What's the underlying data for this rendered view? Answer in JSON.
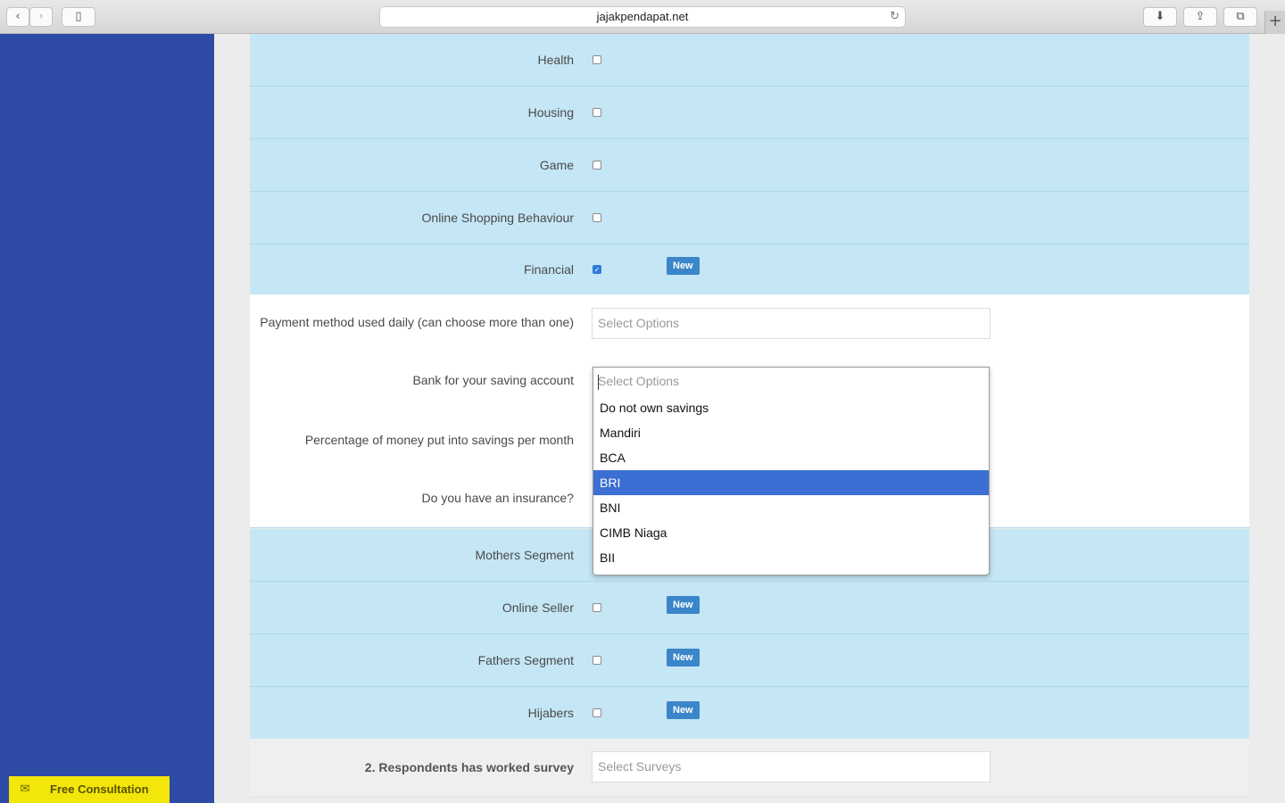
{
  "browser": {
    "url": "jajakpendapat.net",
    "back_icon": "chevron-left",
    "forward_icon": "chevron-right",
    "sidebar_icon": "sidebar",
    "reload_icon": "reload",
    "download_icon": "download",
    "share_icon": "share",
    "tabs_icon": "tabs",
    "newtab_label": "+"
  },
  "segments_top": [
    {
      "label": "Health",
      "checked": false,
      "badge": ""
    },
    {
      "label": "Housing",
      "checked": false,
      "badge": ""
    },
    {
      "label": "Game",
      "checked": false,
      "badge": ""
    },
    {
      "label": "Online Shopping Behaviour",
      "checked": false,
      "badge": ""
    },
    {
      "label": "Financial",
      "checked": true,
      "badge": "New"
    }
  ],
  "financial_questions": {
    "payment_method": {
      "label": "Payment method used daily (can choose more than one)",
      "placeholder": "Select Options"
    },
    "bank_saving": {
      "label": "Bank for your saving account",
      "placeholder": "Select Options"
    },
    "savings_percentage": {
      "label": "Percentage of money put into savings per month"
    },
    "insurance": {
      "label": "Do you have an insurance?"
    }
  },
  "bank_dropdown": {
    "search_placeholder": "Select Options",
    "options": [
      "Do not own savings",
      "Mandiri",
      "BCA",
      "BRI",
      "BNI",
      "CIMB Niaga",
      "BII"
    ],
    "highlighted": "BRI"
  },
  "segments_bottom": [
    {
      "label": "Mothers Segment",
      "checked": false,
      "badge": ""
    },
    {
      "label": "Online Seller",
      "checked": false,
      "badge": "New"
    },
    {
      "label": "Fathers Segment",
      "checked": false,
      "badge": "New"
    },
    {
      "label": "Hijabers",
      "checked": false,
      "badge": "New"
    }
  ],
  "surveys": {
    "label": "2. Respondents has worked survey",
    "placeholder": "Select Surveys"
  },
  "consultation": {
    "label": "Free Consultation",
    "icon": "envelope"
  },
  "colors": {
    "sidebar": "#2e4ba6",
    "segment_row": "#c5e6f5",
    "badge": "#3a86c8",
    "highlight": "#3b6fd4",
    "consult": "#f2e60a"
  }
}
